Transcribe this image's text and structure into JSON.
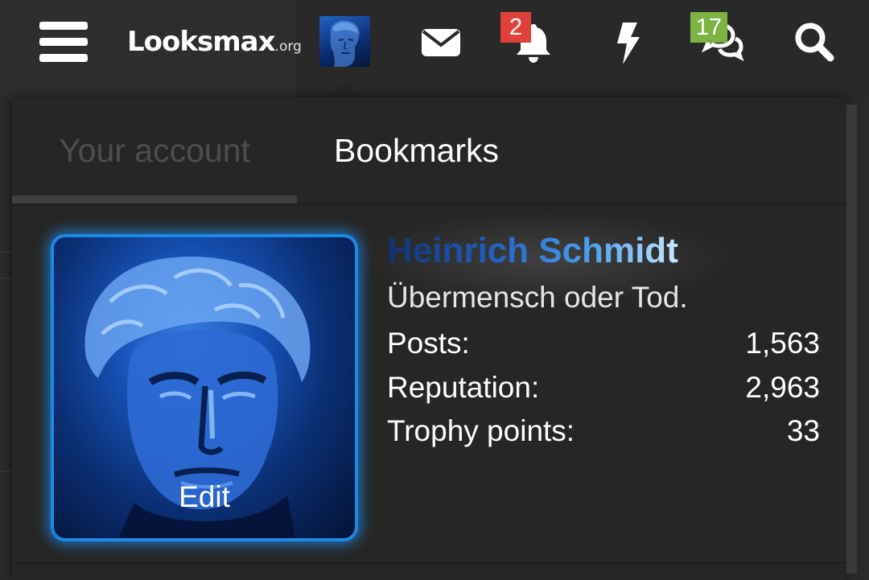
{
  "header": {
    "logo_main": "Looksmax",
    "logo_suffix": ".org",
    "notifications": {
      "alerts_count": "2",
      "conversations_count": "17"
    }
  },
  "account_menu": {
    "tabs": [
      {
        "label": "Your account",
        "active": false
      },
      {
        "label": "Bookmarks",
        "active": true
      }
    ],
    "avatar_edit_label": "Edit",
    "username": "Heinrich Schmidt",
    "user_title": "Übermensch oder Tod.",
    "stats": [
      {
        "label": "Posts:",
        "value": "1,563"
      },
      {
        "label": "Reputation:",
        "value": "2,963"
      },
      {
        "label": "Trophy points:",
        "value": "33"
      }
    ]
  },
  "icons": [
    "menu-icon",
    "envelope-icon",
    "bell-icon",
    "bolt-icon",
    "comments-icon",
    "search-icon"
  ],
  "colors": {
    "badge_alerts": "#e0403a",
    "badge_conversations": "#7cb342",
    "avatar_border": "#1e88e5",
    "background": "#262626"
  }
}
